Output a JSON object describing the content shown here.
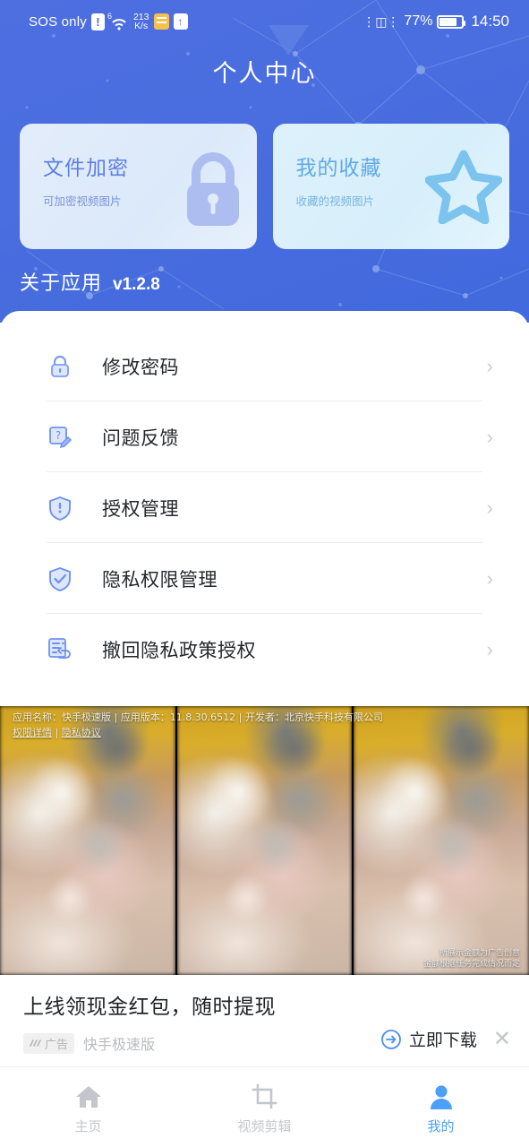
{
  "statusbar": {
    "carrier": "SOS only",
    "warn_icon": "!",
    "wifi_sup": "6",
    "net_speed_value": "213",
    "net_speed_unit": "K/s",
    "battery_percent": "77%",
    "clock": "14:50",
    "icons": [
      "sos-signal-icon",
      "wifi-icon",
      "data-speed-icon",
      "notes-icon",
      "upload-icon",
      "vibrate-icon",
      "battery-icon"
    ]
  },
  "header": {
    "title": "个人中心",
    "accent": "#4a6ddf",
    "about_label": "关于应用",
    "about_version": "v1.2.8"
  },
  "cards": [
    {
      "title": "文件加密",
      "subtitle": "可加密视频图片",
      "icon": "lock-icon",
      "title_color": "#5d7fe0",
      "bg": "#e0ebfa"
    },
    {
      "title": "我的收藏",
      "subtitle": "收藏的视频图片",
      "icon": "star-icon",
      "title_color": "#60a9e6",
      "bg": "#d9f0fb"
    }
  ],
  "menu": [
    {
      "label": "修改密码",
      "icon": "padlock-icon",
      "chevron": "›"
    },
    {
      "label": "问题反馈",
      "icon": "feedback-pencil-icon",
      "chevron": "›"
    },
    {
      "label": "授权管理",
      "icon": "shield-icon",
      "chevron": "›"
    },
    {
      "label": "隐私权限管理",
      "icon": "shield-check-icon",
      "chevron": "›"
    },
    {
      "label": "撤回隐私政策授权",
      "icon": "revoke-document-icon",
      "chevron": "›"
    }
  ],
  "ad": {
    "disclaimer_line1": "应用名称：快手极速版 | 应用版本：11.8.30.6512 | 开发者：北京快手科技有限公司",
    "disclaimer_link1": "权限详情",
    "disclaimer_sep": " | ",
    "disclaimer_link2": "隐私协议",
    "corner_note_line1": "所展示金额为广告创意",
    "corner_note_line2": "金额根据任务完成情况而定",
    "headline": "上线领现金红包，随时提现",
    "badge_label": "广告",
    "app_name": "快手极速版",
    "download_label": "立即下载",
    "download_icon": "arrow-right-circle-icon",
    "close_icon": "close-icon",
    "close_glyph": "✕"
  },
  "bottomnav": {
    "items": [
      {
        "label": "主页",
        "icon": "home-icon",
        "active": false
      },
      {
        "label": "视频剪辑",
        "icon": "crop-icon",
        "active": false
      },
      {
        "label": "我的",
        "icon": "person-icon",
        "active": true
      }
    ],
    "active_color": "#4da0f7",
    "inactive_color": "#c3c6cb"
  }
}
